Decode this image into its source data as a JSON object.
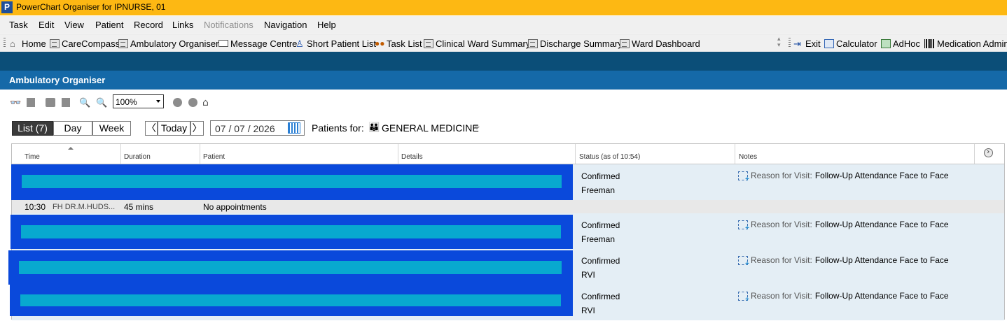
{
  "window": {
    "title": "PowerChart Organiser for IPNURSE, 01",
    "app_icon_letter": "P"
  },
  "menu": [
    "Task",
    "Edit",
    "View",
    "Patient",
    "Record",
    "Links",
    "Notifications",
    "Navigation",
    "Help"
  ],
  "toolbar": {
    "items": [
      "Home",
      "CareCompass",
      "Ambulatory Organiser",
      "Message Centre",
      "Short Patient List",
      "Task List",
      "Clinical Ward Summary",
      "Discharge Summary",
      "Ward Dashboard"
    ],
    "right_items": [
      "Exit",
      "Calculator",
      "AdHoc",
      "Medication Admin"
    ]
  },
  "organiser": {
    "title": "Ambulatory Organiser",
    "zoom": "100%",
    "views": {
      "list": "List  (7)",
      "day": "Day",
      "week": "Week"
    },
    "nav": {
      "prev": "〈",
      "today": "Today",
      "next": "〉"
    },
    "date": "07 / 07 / 2026",
    "patients_for_label": "Patients for:",
    "group": "GENERAL MEDICINE"
  },
  "table": {
    "headers": {
      "time": "Time",
      "duration": "Duration",
      "patient": "Patient",
      "details": "Details",
      "status": "Status (as of 10:54)",
      "notes": "Notes"
    },
    "rows": [
      {
        "status": "Confirmed",
        "location": "Freeman",
        "note_label": "Reason for Visit:",
        "note_value": "Follow-Up Attendance Face to Face"
      },
      {
        "status": "Confirmed",
        "location": "Freeman",
        "note_label": "Reason for Visit:",
        "note_value": "Follow-Up Attendance Face to Face"
      },
      {
        "status": "Confirmed",
        "location": "RVI",
        "note_label": "Reason for Visit:",
        "note_value": "Follow-Up Attendance Face to Face"
      },
      {
        "status": "Confirmed",
        "location": "RVI",
        "note_label": "Reason for Visit:",
        "note_value": "Follow-Up Attendance Face to Face"
      }
    ],
    "free_slot": {
      "time": "10:30",
      "clinician": "FH DR.M.HUDS...",
      "duration": "45 mins",
      "patient": "No appointments"
    }
  },
  "colors": {
    "title_bar": "#FDB813",
    "dark_band": "#0b4e78",
    "header_band": "#1569a8",
    "redaction": "#0a49db",
    "redaction_bar": "#08a9cf"
  }
}
